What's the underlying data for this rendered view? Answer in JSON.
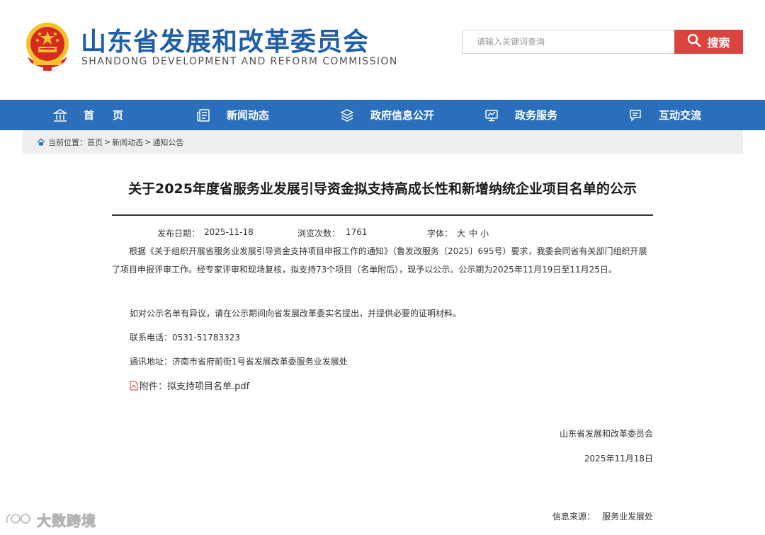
{
  "header": {
    "title": "山东省发展和改革委员会",
    "subtitle": "SHANDONG DEVELOPMENT AND REFORM COMMISSION",
    "search_placeholder": "请输入关键词查询",
    "search_button": "搜索"
  },
  "nav": {
    "items": [
      {
        "label": "首页",
        "icon": "building-icon"
      },
      {
        "label": "新闻动态",
        "icon": "newspaper-icon"
      },
      {
        "label": "政府信息公开",
        "icon": "layers-icon"
      },
      {
        "label": "政务服务",
        "icon": "monitor-icon"
      },
      {
        "label": "互动交流",
        "icon": "chat-icon"
      }
    ]
  },
  "breadcrumb": {
    "prefix": "当前位置：",
    "items": [
      "首页",
      "新闻动态",
      "通知公告"
    ],
    "separator": ">"
  },
  "article": {
    "title": "关于2025年度省服务业发展引导资金拟支持高成长性和新增纳统企业项目名单的公示",
    "meta": {
      "date_label": "发布日期：",
      "date": "2025-11-18",
      "views_label": "浏览次数：",
      "views": "1761",
      "font_label": "字体：",
      "font_large": "大",
      "font_medium": "中",
      "font_small": "小"
    },
    "paragraph1": "根据《关于组织开展省服务业发展引导资金支持项目申报工作的通知》（鲁发改服务〔2025〕695号）要求，我委会同省有关部门组织开展了项目申报评审工作。经专家评审和现场复核，拟支持73个项目（名单附后），现予以公示。公示期为2025年11月19日至11月25日。",
    "paragraph2": "如对公示名单有异议，请在公示期间向省发展改革委实名提出，并提供必要的证明材料。",
    "contact": "联系电话：0531-51783323",
    "address": "通讯地址：济南市省府前街1号省发展改革委服务业发展处",
    "attachment": "附件：拟支持项目名单.pdf",
    "sign_org": "山东省发展和改革委员会",
    "sign_date": "2025年11月18日",
    "source_label": "信息来源：",
    "source": "服务业发展处"
  },
  "watermark": {
    "text": "大数跨境"
  },
  "colors": {
    "brand_blue": "#1f5fa8",
    "nav_blue": "#2a6ebc",
    "search_red": "#d9443f",
    "breadcrumb_bg": "#eeeeee"
  }
}
